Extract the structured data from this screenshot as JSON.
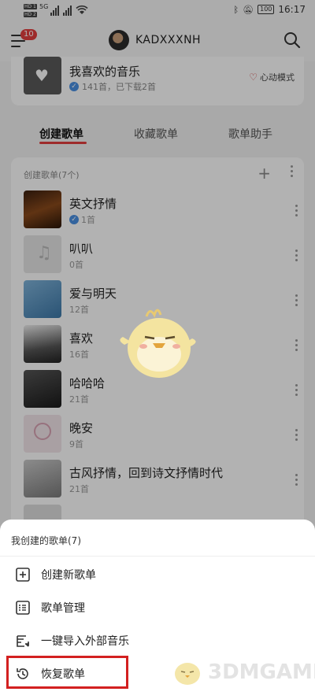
{
  "status_bar": {
    "hd1": "HD 1",
    "hd2": "HD 2",
    "net": "5G",
    "battery": "100",
    "time": "16:17"
  },
  "header": {
    "notification_count": "10",
    "username": "KADXXXNH"
  },
  "favorite": {
    "title": "我喜欢的音乐",
    "subtitle": "141首，已下载2首",
    "mode_label": "心动模式"
  },
  "tabs": [
    {
      "label": "创建歌单"
    },
    {
      "label": "收藏歌单"
    },
    {
      "label": "歌单助手"
    }
  ],
  "playlists": {
    "header": "创建歌单(7个)",
    "items": [
      {
        "name": "英文抒情",
        "count": "1首",
        "verified": true
      },
      {
        "name": "叭叭",
        "count": "0首",
        "verified": false
      },
      {
        "name": "爱与明天",
        "count": "12首",
        "verified": false
      },
      {
        "name": "喜欢",
        "count": "16首",
        "verified": false
      },
      {
        "name": "哈哈哈",
        "count": "21首",
        "verified": false
      },
      {
        "name": "晚安",
        "count": "9首",
        "verified": false
      },
      {
        "name": "古风抒情，回到诗文抒情时代",
        "count": "21首",
        "verified": false
      }
    ]
  },
  "sheet": {
    "title": "我创建的歌单(7)",
    "items": [
      {
        "label": "创建新歌单",
        "icon": "plus-square-icon"
      },
      {
        "label": "歌单管理",
        "icon": "list-icon"
      },
      {
        "label": "一键导入外部音乐",
        "icon": "import-icon"
      },
      {
        "label": "恢复歌单",
        "icon": "history-icon"
      }
    ]
  },
  "watermark": "3DMGAME",
  "colors": {
    "accent": "#e33e3e",
    "highlight_border": "#d32020",
    "verified": "#4a90e2"
  }
}
